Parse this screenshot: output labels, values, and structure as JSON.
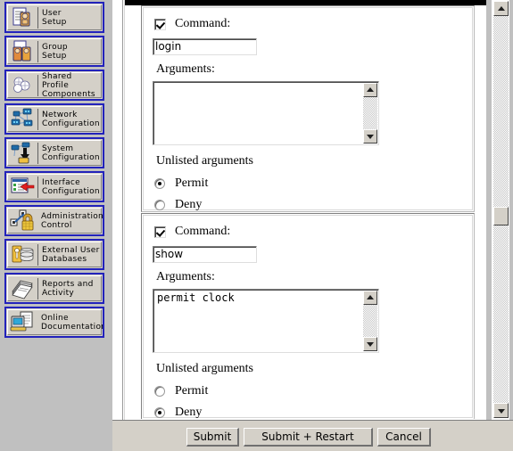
{
  "sidebar": {
    "items": [
      {
        "label": "User\nSetup",
        "icon": "user-setup-icon"
      },
      {
        "label": "Group\nSetup",
        "icon": "group-setup-icon"
      },
      {
        "label": "Shared Profile\nComponents",
        "icon": "shared-profile-components-icon"
      },
      {
        "label": "Network\nConfiguration",
        "icon": "network-configuration-icon"
      },
      {
        "label": "System\nConfiguration",
        "icon": "system-configuration-icon"
      },
      {
        "label": "Interface\nConfiguration",
        "icon": "interface-configuration-icon"
      },
      {
        "label": "Administration\nControl",
        "icon": "administration-control-icon"
      },
      {
        "label": "External User\nDatabases",
        "icon": "external-user-databases-icon"
      },
      {
        "label": "Reports and\nActivity",
        "icon": "reports-and-activity-icon"
      },
      {
        "label": "Online\nDocumentation",
        "icon": "online-documentation-icon"
      }
    ]
  },
  "main": {
    "command_groups": [
      {
        "checkbox_label": "Command:",
        "checked": true,
        "command_value": "login",
        "arguments_label": "Arguments:",
        "arguments_value": "",
        "unlisted_label": "Unlisted arguments",
        "permit_label": "Permit",
        "deny_label": "Deny",
        "selected": "Permit"
      },
      {
        "checkbox_label": "Command:",
        "checked": true,
        "command_value": "show",
        "arguments_label": "Arguments:",
        "arguments_value": "permit clock",
        "unlisted_label": "Unlisted arguments",
        "permit_label": "Permit",
        "deny_label": "Deny",
        "selected": "Deny"
      }
    ]
  },
  "buttons": {
    "submit": "Submit",
    "submit_restart": "Submit + Restart",
    "cancel": "Cancel"
  },
  "colors": {
    "nav_border": "#2222bb",
    "face": "#d4d0c8",
    "desktop": "#c0c0c0"
  }
}
